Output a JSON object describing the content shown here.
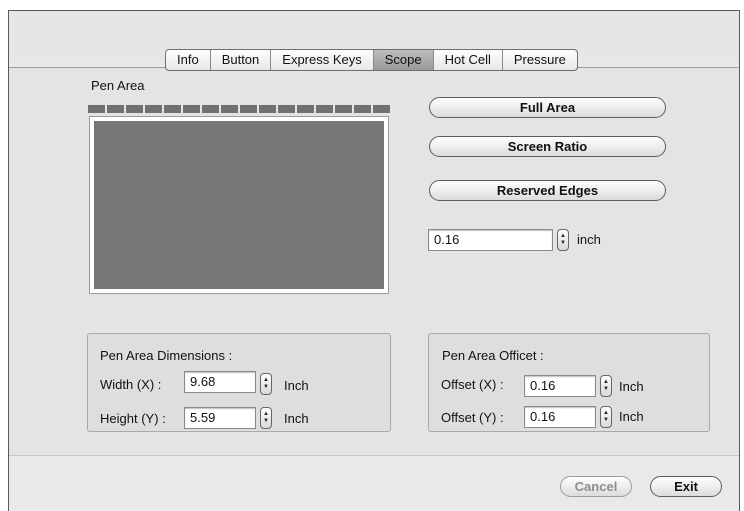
{
  "tabs": [
    {
      "label": "Info",
      "selected": false
    },
    {
      "label": "Button",
      "selected": false
    },
    {
      "label": "Express Keys",
      "selected": false
    },
    {
      "label": "Scope",
      "selected": true
    },
    {
      "label": "Hot Cell",
      "selected": false
    },
    {
      "label": "Pressure",
      "selected": false
    }
  ],
  "pen_area": {
    "title": "Pen Area",
    "buttons": {
      "full_area": "Full Area",
      "screen_ratio": "Screen Ratio",
      "reserved_edges": "Reserved Edges"
    },
    "edge_value": "0.16",
    "edge_unit": "inch"
  },
  "dimensions": {
    "title": "Pen Area Dimensions :",
    "width_label": "Width  (X) :",
    "width_value": "9.68",
    "width_unit": "Inch",
    "height_label": "Height (Y) :",
    "height_value": "5.59",
    "height_unit": "Inch"
  },
  "offset": {
    "title": "Pen Area Officet :",
    "x_label": "Offset (X) :",
    "x_value": "0.16",
    "x_unit": "Inch",
    "y_label": "Offset (Y) :",
    "y_value": "0.16",
    "y_unit": "Inch"
  },
  "footer": {
    "cancel": "Cancel",
    "exit": "Exit"
  }
}
